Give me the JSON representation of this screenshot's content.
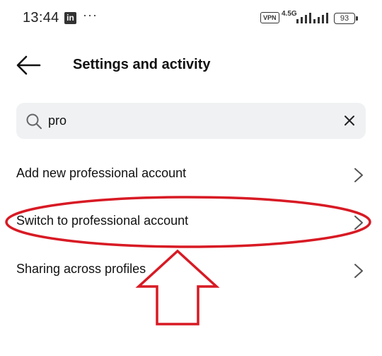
{
  "status_bar": {
    "time": "13:44",
    "app_icon_letters": "in",
    "more_dots": "···",
    "vpn": "VPN",
    "network": "4.5G",
    "battery": "93"
  },
  "header": {
    "title": "Settings and activity"
  },
  "search": {
    "value": "pro"
  },
  "results": [
    {
      "label": "Add new professional account"
    },
    {
      "label": "Switch to professional account"
    },
    {
      "label": "Sharing across profiles"
    }
  ],
  "colors": {
    "annotation": "#d81a24",
    "search_bg": "#eff1f3"
  }
}
